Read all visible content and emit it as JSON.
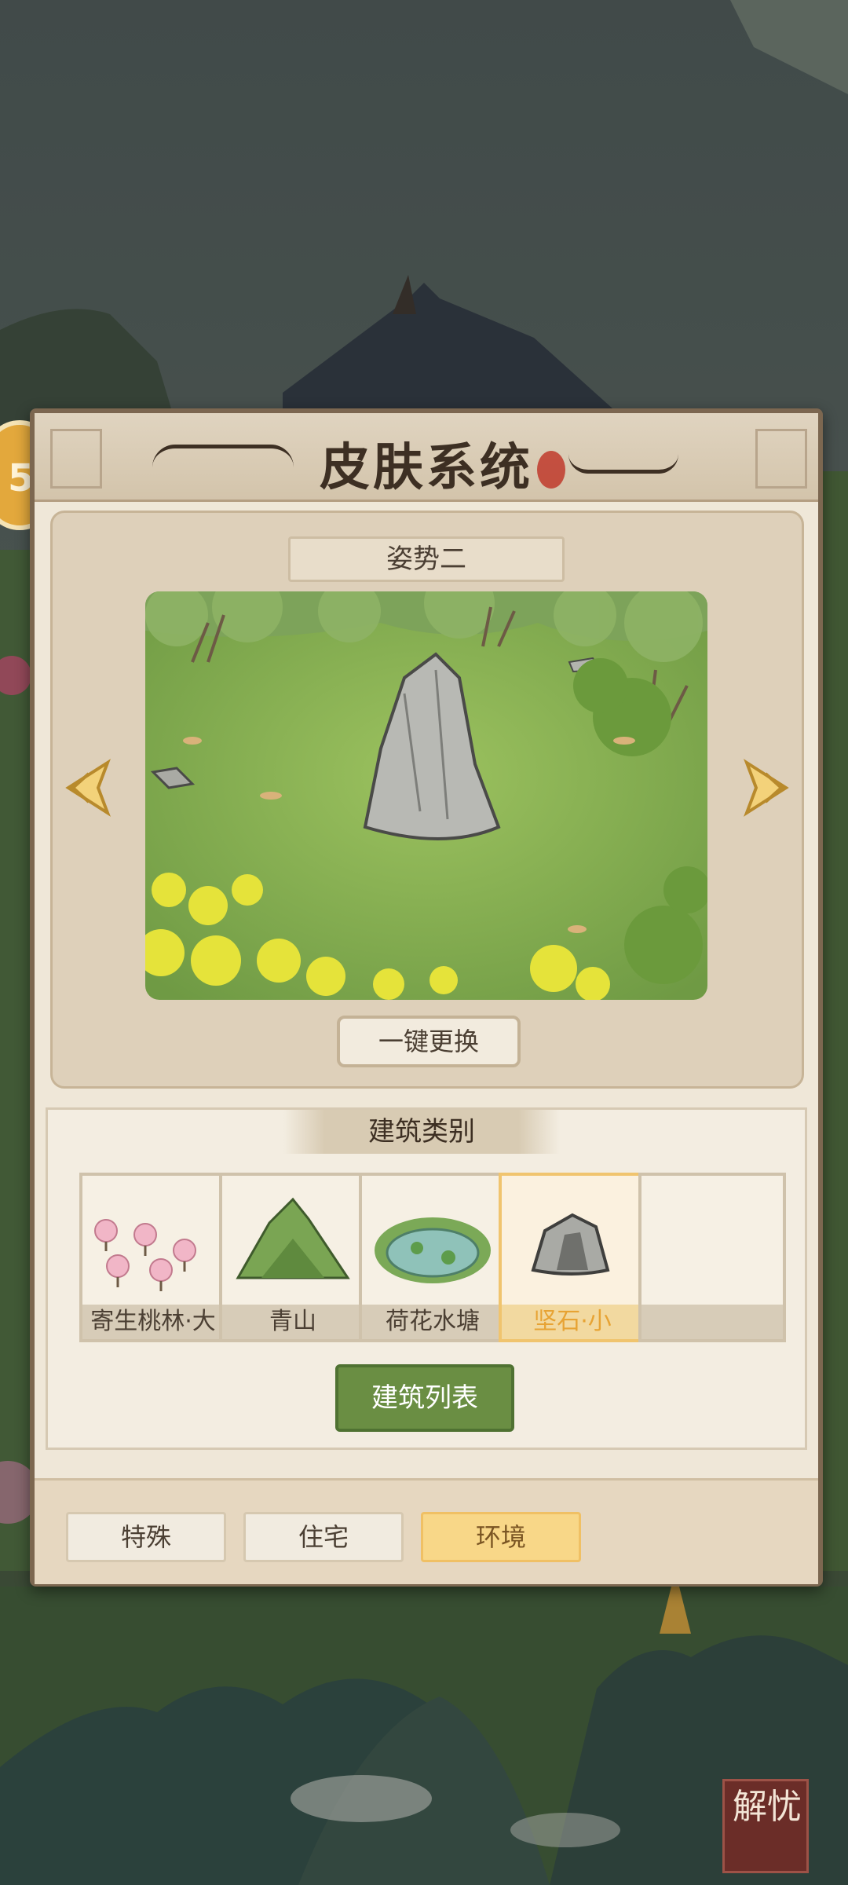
{
  "header": {
    "title": "皮肤系统"
  },
  "preview": {
    "pose_label": "姿势二",
    "swap_button": "一键更换",
    "prev_icon": "chevron-left-icon",
    "next_icon": "chevron-right-icon"
  },
  "categories": {
    "title": "建筑类别",
    "cards": [
      {
        "label": "寄生桃林·大",
        "icon": "peach-grove-icon",
        "selected": false
      },
      {
        "label": "青山",
        "icon": "green-mountain-icon",
        "selected": false
      },
      {
        "label": "荷花水塘",
        "icon": "lotus-pond-icon",
        "selected": false
      },
      {
        "label": "坚石·小",
        "icon": "rock-icon",
        "selected": true
      }
    ],
    "list_button": "建筑列表"
  },
  "tabs": [
    {
      "label": "特殊",
      "active": false
    },
    {
      "label": "住宅",
      "active": false
    },
    {
      "label": "环境",
      "active": true
    }
  ],
  "corner_button": {
    "label": "解忧"
  },
  "colors": {
    "accent": "#f0c46e",
    "primary_button": "#6a8e43",
    "panel": "#efe7d8"
  }
}
